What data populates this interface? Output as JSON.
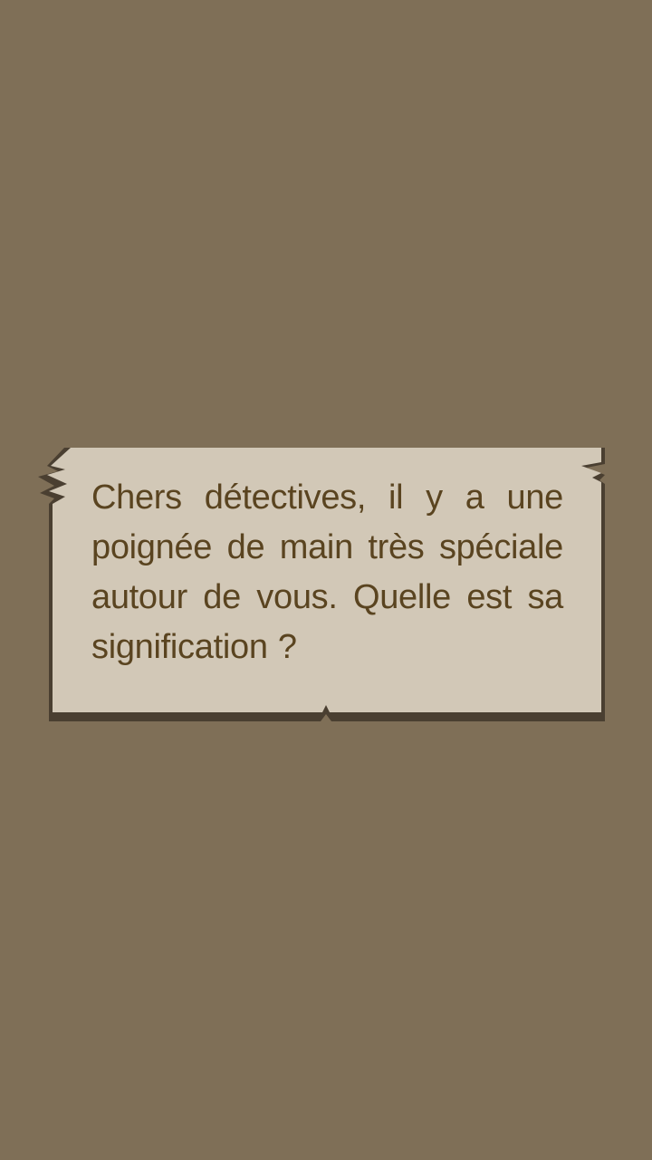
{
  "dialog": {
    "message": "Chers détectives, il y a une poignée de main très spéciale autour de vous. Quelle est sa signification ?"
  },
  "colors": {
    "background": "#7f6f57",
    "note_paper": "#d2c8b7",
    "note_shadow": "#4a3f31",
    "text": "#5a4420"
  }
}
